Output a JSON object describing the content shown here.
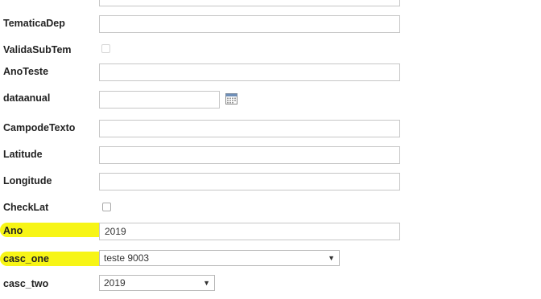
{
  "form": {
    "tematica_dep_label": "TematicaDep",
    "valida_sub_tem_label": "ValidaSubTem",
    "ano_teste_label": "AnoTeste",
    "dataanual_label": "dataanual",
    "campode_texto_label": "CampodeTexto",
    "latitude_label": "Latitude",
    "longitude_label": "Longitude",
    "check_lat_label": "CheckLat",
    "ano_label": "Ano",
    "ano_value": "2019",
    "casc_one_label": "casc_one",
    "casc_one_value": "teste 9003",
    "casc_two_label": "casc_two",
    "casc_two_value": "2019"
  },
  "colors": {
    "highlight": "#f7f40a",
    "input_border": "#c6c6c6"
  },
  "icons": {
    "calendar": "calendar-icon",
    "dropdown": "chevron-down-icon"
  }
}
